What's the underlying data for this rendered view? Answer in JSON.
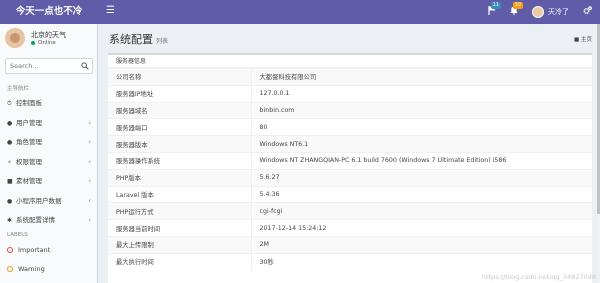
{
  "header": {
    "logo": "今天一点也不冷",
    "toggle_icon": "bars-icon",
    "notifications_badge": "11",
    "messages_badge": "10",
    "user_name": "天冷了"
  },
  "sidebar": {
    "user_name": "北京的天气",
    "status": "Online",
    "search_placeholder": "Search...",
    "nav_heading": "主导航栏",
    "items": [
      {
        "label": "控制面板",
        "icon": "dashboard-icon",
        "has_children": false
      },
      {
        "label": "用户管理",
        "icon": "user-icon",
        "has_children": true
      },
      {
        "label": "角色管理",
        "icon": "users-icon",
        "has_children": true
      },
      {
        "label": "权限管理",
        "icon": "key-icon",
        "has_children": true
      },
      {
        "label": "素材管理",
        "icon": "folder-icon",
        "has_children": true
      },
      {
        "label": "小程序用户数据",
        "icon": "users-icon",
        "has_children": true
      },
      {
        "label": "系统配置详情",
        "icon": "cogs-icon",
        "has_children": true
      }
    ],
    "labels_heading": "LABELS",
    "labels": [
      {
        "label": "Important",
        "color": "#dd4b39"
      },
      {
        "label": "Warning",
        "color": "#f39c12"
      }
    ]
  },
  "content": {
    "title": "系统配置",
    "subtitle": "列表",
    "breadcrumb": "主页",
    "box_title": "服务器信息",
    "rows": [
      {
        "key": "公司名称",
        "value": "大都督科技有限公司"
      },
      {
        "key": "服务器IP地址",
        "value": "127.0.0.1"
      },
      {
        "key": "服务器域名",
        "value": "binbin.com"
      },
      {
        "key": "服务器端口",
        "value": "80"
      },
      {
        "key": "服务器版本",
        "value": "Windows NT6.1"
      },
      {
        "key": "服务器操作系统",
        "value": "Windows NT ZHANGQIAN-PC 6.1 build 7600 (Windows 7 Ultimate Edition) i586"
      },
      {
        "key": "PHP版本",
        "value": "5.6.27"
      },
      {
        "key": "Laravel 版本",
        "value": "5.4.36"
      },
      {
        "key": "PHP运行方式",
        "value": "cgi-fcgi"
      },
      {
        "key": "服务器当前时间",
        "value": "2017-12-14 15:24:12"
      },
      {
        "key": "最大上传限制",
        "value": "2M"
      },
      {
        "key": "最大执行时间",
        "value": "30秒"
      }
    ]
  },
  "watermark": "https://blog.csdn.net/qq_34827048",
  "colors": {
    "header": "#605ca8",
    "sidebar": "#f9fafc",
    "content_bg": "#ecf0f5",
    "online": "#00a65a"
  }
}
